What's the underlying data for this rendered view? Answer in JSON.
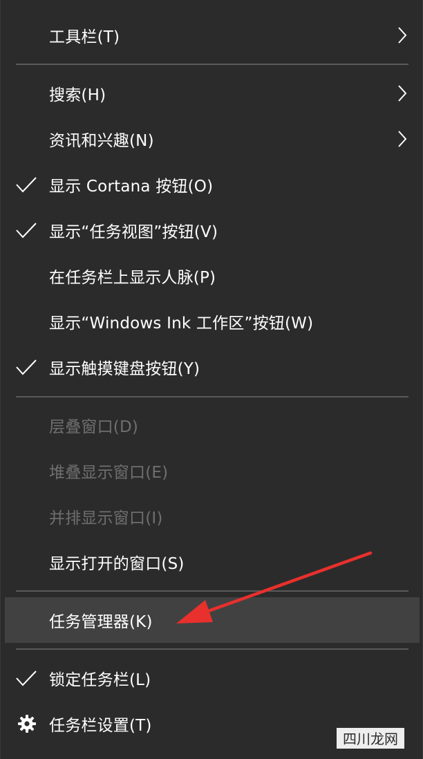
{
  "menu": {
    "toolbar": {
      "label": "工具栏(T)"
    },
    "search": {
      "label": "搜索(H)"
    },
    "news_interests": {
      "label": "资讯和兴趣(N)"
    },
    "show_cortana": {
      "label": "显示 Cortana 按钮(O)",
      "checked": true
    },
    "show_task_view": {
      "label": "显示“任务视图”按钮(V)",
      "checked": true
    },
    "show_people": {
      "label": "在任务栏上显示人脉(P)",
      "checked": false
    },
    "show_ink": {
      "label": "显示“Windows Ink 工作区”按钮(W)",
      "checked": false
    },
    "show_touch_keyboard": {
      "label": "显示触摸键盘按钮(Y)",
      "checked": true
    },
    "cascade": {
      "label": "层叠窗口(D)",
      "enabled": false
    },
    "stack": {
      "label": "堆叠显示窗口(E)",
      "enabled": false
    },
    "side_by_side": {
      "label": "并排显示窗口(I)",
      "enabled": false
    },
    "show_open_windows": {
      "label": "显示打开的窗口(S)"
    },
    "task_manager": {
      "label": "任务管理器(K)",
      "highlighted": true
    },
    "lock_taskbar": {
      "label": "锁定任务栏(L)",
      "checked": true
    },
    "taskbar_settings": {
      "label": "任务栏设置(T)"
    }
  },
  "watermark": {
    "text": "四川龙网"
  },
  "colors": {
    "menu_bg": "#2b2b2b",
    "highlight_bg": "#414141",
    "text": "#ffffff",
    "disabled_text": "#6f6f6f",
    "separator": "#5a5a5a",
    "annotation_arrow": "#e8302c"
  }
}
